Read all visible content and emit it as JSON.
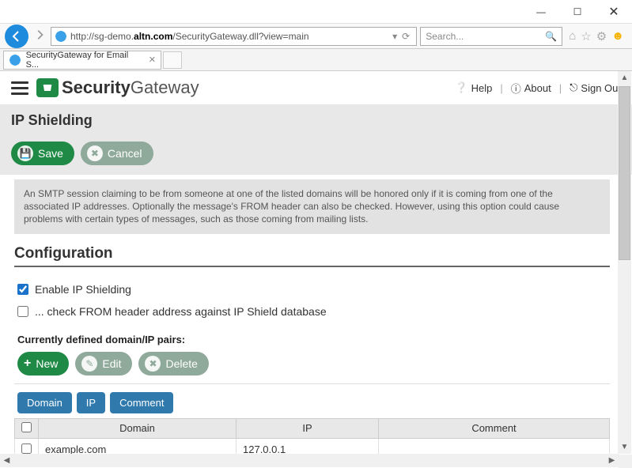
{
  "window": {
    "url_prefix": "http://sg-demo.",
    "url_host": "altn.com",
    "url_path": "/SecurityGateway.dll?view=main",
    "search_placeholder": "Search...",
    "tab_title": "SecurityGateway for Email S..."
  },
  "header": {
    "brand_strong": "Security",
    "brand_rest": "Gateway",
    "help": "Help",
    "about": "About",
    "signout": "Sign Out"
  },
  "page_title": "IP Shielding",
  "actions": {
    "save": "Save",
    "cancel": "Cancel"
  },
  "info_text": "An SMTP session claiming to be from someone at one of the listed domains will be honored only if it is coming from one of the associated IP addresses. Optionally the message's FROM header can also be checked. However, using this option could cause problems with certain types of messages, such as those coming from mailing lists.",
  "config": {
    "heading": "Configuration",
    "enable_label": "Enable IP Shielding",
    "check_from_label": "... check FROM header address against IP Shield database",
    "pairs_heading": "Currently defined domain/IP pairs:",
    "new": "New",
    "edit": "Edit",
    "delete": "Delete",
    "col_domain": "Domain",
    "col_ip": "IP",
    "col_comment": "Comment",
    "rows": [
      {
        "domain": "example.com",
        "ip": "127.0.0.1",
        "comment": ""
      }
    ]
  }
}
